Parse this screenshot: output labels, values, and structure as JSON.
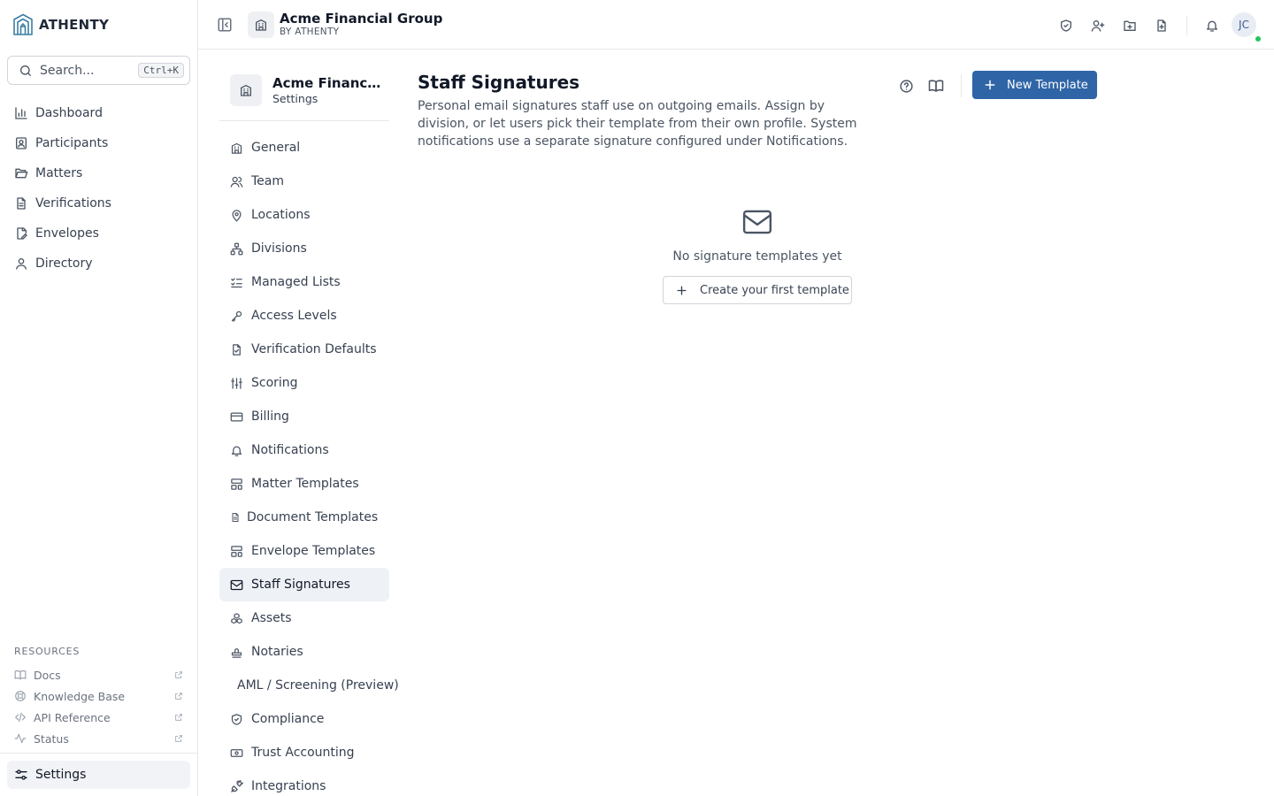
{
  "brand": {
    "name": "ATHENTY"
  },
  "search": {
    "placeholder": "Search...",
    "shortcut": "Ctrl+K"
  },
  "sidebar": {
    "items": [
      {
        "label": "Dashboard",
        "icon": "bar-chart-icon"
      },
      {
        "label": "Participants",
        "icon": "contact-icon"
      },
      {
        "label": "Matters",
        "icon": "folder-open-icon"
      },
      {
        "label": "Verifications",
        "icon": "file-text-icon"
      },
      {
        "label": "Envelopes",
        "icon": "file-signature-icon"
      },
      {
        "label": "Directory",
        "icon": "user-icon"
      }
    ],
    "resources_title": "RESOURCES",
    "resources": [
      {
        "label": "Docs",
        "icon": "book-icon"
      },
      {
        "label": "Knowledge Base",
        "icon": "life-buoy-icon"
      },
      {
        "label": "API Reference",
        "icon": "code-icon"
      },
      {
        "label": "Status",
        "icon": "activity-icon"
      }
    ],
    "settings_label": "Settings"
  },
  "header": {
    "org_name": "Acme Financial Group",
    "org_sub": "BY ATHENTY",
    "avatar_initials": "JC",
    "action_icons": [
      "shield-check-icon",
      "user-plus-icon",
      "folder-plus-icon",
      "file-plus-icon",
      "bell-icon"
    ]
  },
  "settings_nav": {
    "org_name": "Acme Financial Group",
    "subtitle": "Settings",
    "items": [
      {
        "label": "General",
        "icon": "building-icon"
      },
      {
        "label": "Team",
        "icon": "users-icon"
      },
      {
        "label": "Locations",
        "icon": "map-pin-icon"
      },
      {
        "label": "Divisions",
        "icon": "network-icon"
      },
      {
        "label": "Managed Lists",
        "icon": "list-checks-icon"
      },
      {
        "label": "Access Levels",
        "icon": "key-icon"
      },
      {
        "label": "Verification Defaults",
        "icon": "file-check-icon"
      },
      {
        "label": "Scoring",
        "icon": "sliders-icon"
      },
      {
        "label": "Billing",
        "icon": "credit-card-icon"
      },
      {
        "label": "Notifications",
        "icon": "bell-icon"
      },
      {
        "label": "Matter Templates",
        "icon": "layout-template-icon"
      },
      {
        "label": "Document Templates",
        "icon": "file-lines-icon"
      },
      {
        "label": "Envelope Templates",
        "icon": "layout-template-icon"
      },
      {
        "label": "Staff Signatures",
        "icon": "mail-icon",
        "active": true
      },
      {
        "label": "Assets",
        "icon": "boxes-icon"
      },
      {
        "label": "Notaries",
        "icon": "stamp-icon"
      },
      {
        "label": "AML / Screening (Preview)",
        "icon": ""
      },
      {
        "label": "Compliance",
        "icon": "shield-check-icon"
      },
      {
        "label": "Trust Accounting",
        "icon": "banknote-icon"
      },
      {
        "label": "Integrations",
        "icon": "plug-icon"
      }
    ]
  },
  "main": {
    "title": "Staff Signatures",
    "description": "Personal email signatures staff use on outgoing emails. Assign by division, or let users pick their template from their own profile. System notifications use a separate signature configured under Notifications.",
    "new_button": "New Template",
    "empty_text": "No signature templates yet",
    "create_button": "Create your first template"
  },
  "colors": {
    "primary": "#2f65a7",
    "brand_teal": "#3b7ea1",
    "presence": "#22c55e"
  }
}
